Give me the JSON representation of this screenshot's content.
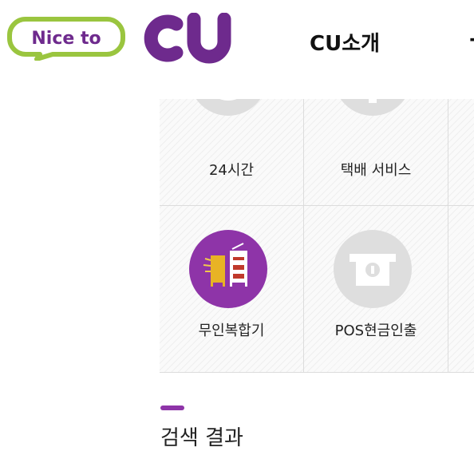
{
  "brand": {
    "tagline": "Nice to",
    "name": "CU",
    "colors": {
      "purple": "#6e2a8d",
      "green": "#9ac53f",
      "service_active": "#8e34a8",
      "service_inactive": "#dedede"
    }
  },
  "nav": {
    "items": [
      "CU소개",
      "-"
    ]
  },
  "services": [
    {
      "label": "24시간",
      "icon": "clock-icon",
      "active": false
    },
    {
      "label": "택배 서비스",
      "icon": "parcel-icon",
      "active": false
    },
    {
      "label": "무인복합기",
      "icon": "multifunction-printer-icon",
      "active": true
    },
    {
      "label": "POS현금인출",
      "icon": "atm-cash-icon",
      "active": false
    }
  ],
  "results": {
    "title": "검색 결과"
  }
}
